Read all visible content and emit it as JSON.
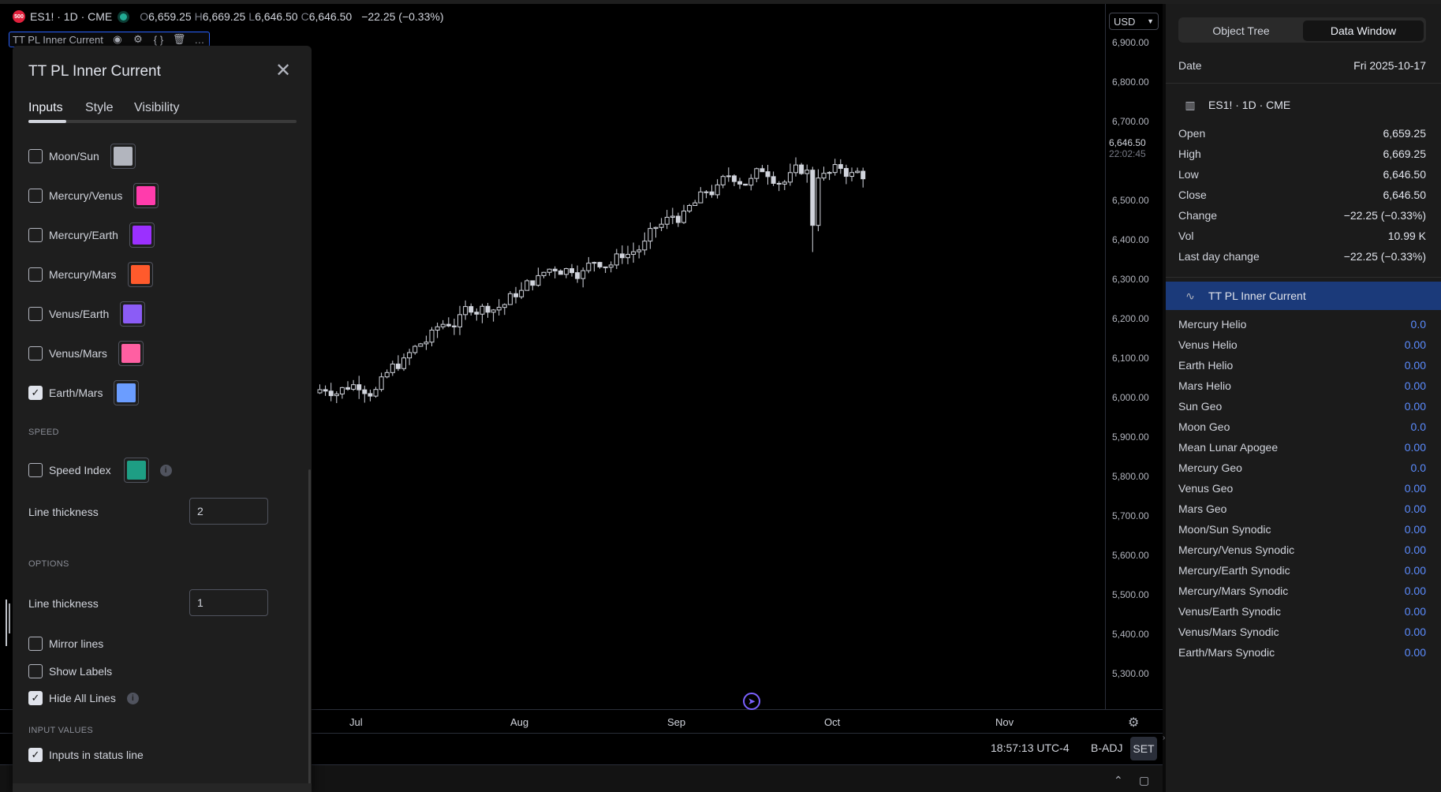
{
  "header": {
    "symbol_badge": "500",
    "symbol": "ES1! · 1D · CME",
    "ohlc": [
      {
        "k": "O",
        "v": "6,659.25"
      },
      {
        "k": "H",
        "v": "6,669.25"
      },
      {
        "k": "L",
        "v": "6,646.50"
      },
      {
        "k": "C",
        "v": "6,646.50"
      }
    ],
    "change": "−22.25 (−0.33%)",
    "indicator_name": "TT PL Inner Current"
  },
  "price_axis": {
    "currency": "USD",
    "ticks": [
      "6,900.00",
      "6,800.00",
      "6,700.00",
      "6,500.00",
      "6,400.00",
      "6,300.00",
      "6,200.00",
      "6,100.00",
      "6,000.00",
      "5,900.00",
      "5,800.00",
      "5,700.00",
      "5,600.00",
      "5,500.00",
      "5,400.00",
      "5,300.00"
    ],
    "last_price": "6,646.50",
    "countdown": "22:02:45"
  },
  "time_axis": {
    "labels": [
      "Jul",
      "Aug",
      "Sep",
      "Oct",
      "Nov"
    ]
  },
  "status": {
    "clock": "18:57:13 UTC-4",
    "badj": "B-ADJ",
    "set": "SET"
  },
  "dialog": {
    "title": "TT PL Inner Current",
    "tabs": [
      "Inputs",
      "Style",
      "Visibility"
    ],
    "pairs": [
      {
        "label": "Moon/Sun",
        "checked": false,
        "color": "#b2b5be"
      },
      {
        "label": "Mercury/Venus",
        "checked": false,
        "color": "#ff3cac"
      },
      {
        "label": "Mercury/Earth",
        "checked": false,
        "color": "#9b30ff"
      },
      {
        "label": "Mercury/Mars",
        "checked": false,
        "color": "#ff5a2c"
      },
      {
        "label": "Venus/Earth",
        "checked": false,
        "color": "#8b5cf6"
      },
      {
        "label": "Venus/Mars",
        "checked": false,
        "color": "#ff5fa2"
      },
      {
        "label": "Earth/Mars",
        "checked": true,
        "color": "#6b9dff"
      }
    ],
    "speed_section": "SPEED",
    "speed_index": {
      "label": "Speed Index",
      "checked": false,
      "color": "#1e9e84"
    },
    "speed_thickness_label": "Line thickness",
    "speed_thickness_value": "2",
    "options_section": "OPTIONS",
    "options_thickness_label": "Line thickness",
    "options_thickness_value": "1",
    "options": [
      {
        "label": "Mirror lines",
        "checked": false
      },
      {
        "label": "Show Labels",
        "checked": false
      },
      {
        "label": "Hide All Lines",
        "checked": true
      }
    ],
    "input_values_section": "INPUT VALUES",
    "status_line": {
      "label": "Inputs in status line",
      "checked": true
    }
  },
  "data_window": {
    "tabs": [
      "Object Tree",
      "Data Window"
    ],
    "date_label": "Date",
    "date_value": "Fri 2025-10-17",
    "symbol": "ES1! · 1D · CME",
    "symbol_rows": [
      {
        "k": "Open",
        "v": "6,659.25"
      },
      {
        "k": "High",
        "v": "6,669.25"
      },
      {
        "k": "Low",
        "v": "6,646.50"
      },
      {
        "k": "Close",
        "v": "6,646.50"
      },
      {
        "k": "Change",
        "v": "−22.25 (−0.33%)"
      },
      {
        "k": "Vol",
        "v": "10.99 K"
      },
      {
        "k": "Last day change",
        "v": "−22.25 (−0.33%)"
      }
    ],
    "indicator": "TT PL Inner Current",
    "indicator_rows": [
      {
        "k": "Mercury Helio",
        "v": "0.0"
      },
      {
        "k": "Venus Helio",
        "v": "0.00"
      },
      {
        "k": "Earth Helio",
        "v": "0.00"
      },
      {
        "k": "Mars Helio",
        "v": "0.00"
      },
      {
        "k": "Sun Geo",
        "v": "0.00"
      },
      {
        "k": "Moon Geo",
        "v": "0.0"
      },
      {
        "k": "Mean Lunar Apogee",
        "v": "0.00"
      },
      {
        "k": "Mercury Geo",
        "v": "0.0"
      },
      {
        "k": "Venus Geo",
        "v": "0.00"
      },
      {
        "k": "Mars Geo",
        "v": "0.00"
      },
      {
        "k": "Moon/Sun Synodic",
        "v": "0.00"
      },
      {
        "k": "Mercury/Venus Synodic",
        "v": "0.00"
      },
      {
        "k": "Mercury/Earth Synodic",
        "v": "0.00"
      },
      {
        "k": "Mercury/Mars Synodic",
        "v": "0.00"
      },
      {
        "k": "Venus/Earth Synodic",
        "v": "0.00"
      },
      {
        "k": "Venus/Mars Synodic",
        "v": "0.00"
      },
      {
        "k": "Earth/Mars Synodic",
        "v": "0.00"
      }
    ]
  },
  "colors": {
    "accent": "#2962ff",
    "selected_row": "#1b3a7a",
    "value_blue": "#5b8cff",
    "candle": "#d1d4dc"
  }
}
